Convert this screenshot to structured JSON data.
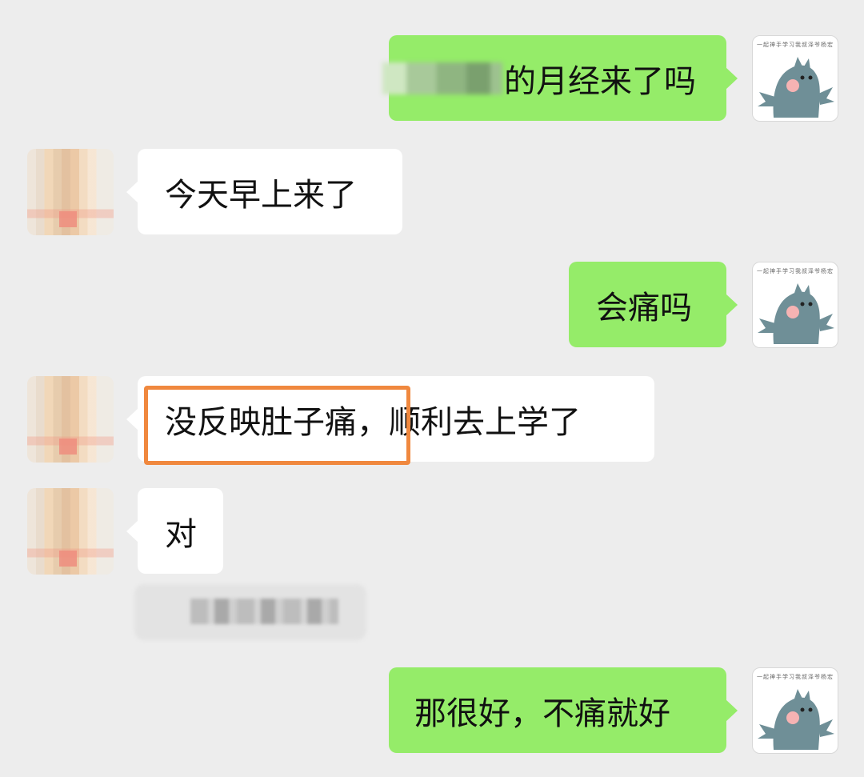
{
  "messages": [
    {
      "sender": "self",
      "text_visible_suffix": "的月经来了吗",
      "redacted_prefix": true
    },
    {
      "sender": "other",
      "text": "今天早上来了"
    },
    {
      "sender": "self",
      "text": "会痛吗"
    },
    {
      "sender": "other",
      "text_highlighted": "没反映肚子痛，",
      "text_rest": "顺利去上学了",
      "highlight_color": "#f0883e"
    },
    {
      "sender": "other",
      "text": "对"
    },
    {
      "sender": "other",
      "redacted_message": true
    },
    {
      "sender": "self",
      "text": "那很好，不痛就好"
    }
  ],
  "avatars": {
    "self": {
      "icon": "cartoon-dinosaur-icon",
      "caption": "一起神手学习我叔泽爷杨宏"
    },
    "other": {
      "icon": "pixelated-photo-icon"
    }
  },
  "colors": {
    "background": "#ededed",
    "self_bubble": "#95ec69",
    "other_bubble": "#ffffff",
    "highlight": "#f0883e"
  }
}
